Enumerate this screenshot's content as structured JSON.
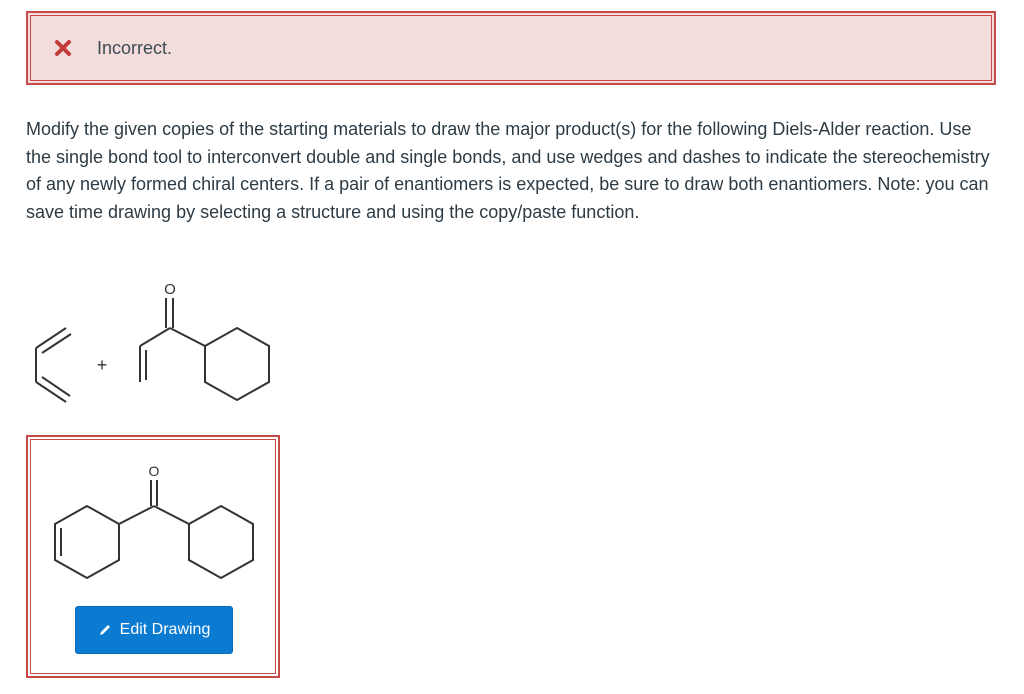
{
  "feedback": {
    "icon": "x-icon",
    "status_text": "Incorrect.",
    "border_color": "#c64a4a",
    "background_color": "#f3dcdc"
  },
  "question": {
    "prompt": "Modify the given copies of the starting materials to draw the major product(s) for the following Diels-Alder reaction. Use the single bond tool to interconvert double and single bonds, and use wedges and dashes to indicate the stereochemistry of any newly formed chiral centers. If a pair of enantiomers is expected, be sure to draw both enantiomers. Note: you can save time drawing by selecting a structure and using the copy/paste function."
  },
  "reaction": {
    "plus_sign": "+",
    "oxygen_label": "O",
    "reactants": [
      "diene",
      "cyclohexyl vinyl ketone"
    ]
  },
  "answer": {
    "oxygen_label": "O",
    "edit_button_label": "Edit Drawing",
    "edit_button_icon": "pencil-icon",
    "button_color": "#0b7bd2"
  }
}
